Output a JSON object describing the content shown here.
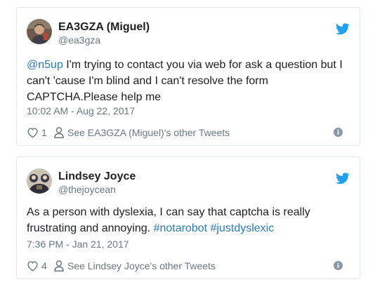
{
  "colors": {
    "link": "#2b7bb9",
    "muted": "#697882",
    "text": "#1c2022",
    "border": "#e1e8ed",
    "twitter_blue": "#1da1f2"
  },
  "tweets": [
    {
      "display_name": "EA3GZA (Miguel)",
      "handle": "@ea3gza",
      "avatar_icon": "user-photo-avatar",
      "brand_icon": "twitter-bird-icon",
      "text_parts": [
        {
          "type": "mention",
          "text": "@n5up"
        },
        {
          "type": "text",
          "text": " I'm trying to contact you via web for ask a question but I can't 'cause I'm blind and I can't resolve the form CAPTCHA.Please help me"
        }
      ],
      "timestamp": "10:02 AM - Aug 22, 2017",
      "like_count": "1",
      "other_tweets_label": "See EA3GZA (Miguel)'s other Tweets",
      "icons": {
        "like": "heart-icon",
        "profile": "person-icon",
        "info": "info-icon"
      }
    },
    {
      "display_name": "Lindsey Joyce",
      "handle": "@thejoycean",
      "avatar_icon": "user-photo-avatar",
      "brand_icon": "twitter-bird-icon",
      "text_parts": [
        {
          "type": "text",
          "text": "As a person with dyslexia, I can say that captcha is really frustrating and annoying. "
        },
        {
          "type": "hashtag",
          "text": "#notarobot"
        },
        {
          "type": "text",
          "text": " "
        },
        {
          "type": "hashtag",
          "text": "#justdyslexic"
        }
      ],
      "timestamp": "7:36 PM - Jan 21, 2017",
      "like_count": "4",
      "other_tweets_label": "See Lindsey Joyce's other Tweets",
      "icons": {
        "like": "heart-icon",
        "profile": "person-icon",
        "info": "info-icon"
      }
    }
  ]
}
